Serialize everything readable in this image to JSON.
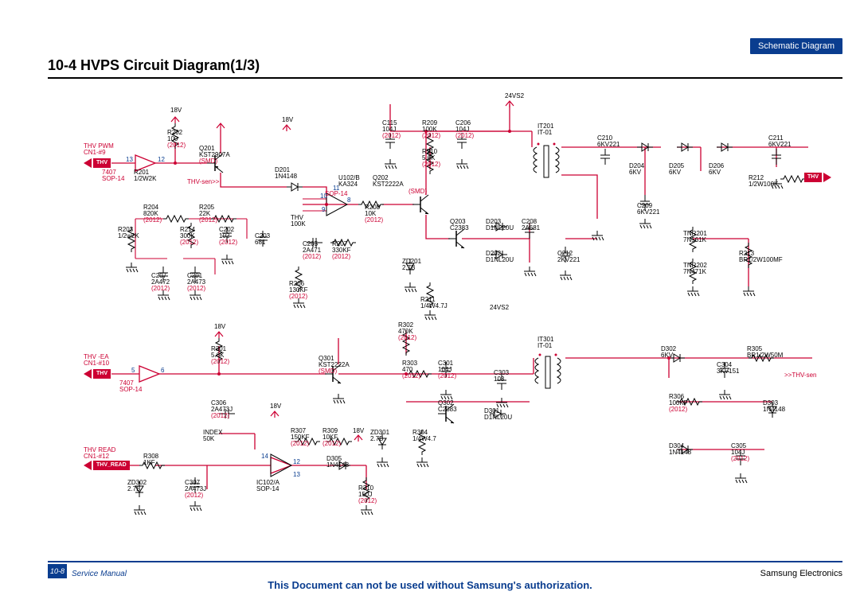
{
  "header": {
    "corner_label": "Schematic Diagram",
    "title": "10-4  HVPS Circuit Diagram(1/3)"
  },
  "footer": {
    "page_num": "10-8",
    "manual_label": "Service Manual",
    "center_text": "This Document can not be used without Samsung's authorization.",
    "right_text": "Samsung Electronics"
  },
  "rails": {
    "r24vs2_top": "24VS2",
    "r18v_a": "18V",
    "r18v_b": "18V",
    "r18v_c": "18V",
    "r18v_d": "18V",
    "r18v_e": "18V",
    "r24vs2_mid": "24VS2"
  },
  "signals": {
    "thv_pwm": "THV PWM\nCN1-#9",
    "thv_pill": "THV",
    "thv_sen": "THV-sen>>",
    "thv_ea": "THV -EA\nCN1-#10",
    "thv_ea_pill": "THV",
    "thv_read": "THV READ\nCN1-#12",
    "thv_read_pill": "THV_READ",
    "index": "INDEX\n50K",
    "thv_out": "THV",
    "thv_sen_out": ">>THV-sen"
  },
  "parts": {
    "r201": "R201\n1/2W2K",
    "r201_ic": "7407\nSOP-14",
    "r202": "R202\n100",
    "r202_pkg": "(2012)",
    "q201": "Q201\nKST2907A",
    "q201_pkg": "(SMD)",
    "d201": "D201\n1N4148",
    "u102b": "U102/B\nKA324",
    "u102b_pkg": "SOP-14",
    "q202": "Q202\nKST2222A",
    "q202_pkg": "(SMD)",
    "c115": "C115\n104J",
    "c115_pkg": "(2012)",
    "r209": "R209\n100K",
    "r209_pkg": "(2012)",
    "c206": "C206\n104J",
    "c206_pkg": "(2012)",
    "r210": "R210\n5.6K",
    "r210_pkg": "(2012)",
    "it201": "IT201\nIT-01",
    "c210": "C210\n6KV221",
    "c211": "C211\n6KV221",
    "d204": "D204\n6KV",
    "d205": "D205\n6KV",
    "d206": "D206\n6KV",
    "r212": "R212\n1/2W100K",
    "c209": "C209\n6KV221",
    "q203": "Q203\nC2383",
    "d203": "D203\nD1NL20U",
    "c208": "C208\n2A681",
    "d202": "D202\nD1NL20U",
    "c212": "C212\n2KV221",
    "tnr201": "TNR201\n7N561K",
    "tnr202": "TNR202\n7N471K",
    "r213": "R213\nBR1/2W100MF",
    "r204": "R204\n820K",
    "r204_pkg": "(2012)",
    "r205": "R205\n22K",
    "r205_pkg": "(2012)",
    "r214": "R214\n300K",
    "r214_pkg": "(2012)",
    "c202": "C202\n102",
    "c202_pkg": "(2012)",
    "c203": "C203\n681",
    "thv_tap": "THV\n100K",
    "r203": "R203\n1/2w2K",
    "c205": "C205\n2A471",
    "c205_pkg": "(2012)",
    "r207": "R207\n330KF",
    "r207_pkg": "(2012)",
    "r208": "R208\n10K",
    "r208_pkg": "(2012)",
    "zd201": "ZD201\n2.7B",
    "r211": "R211\n1/4W4.7J",
    "c207": "C207\n2A472",
    "c207_pkg": "(2012)",
    "c201": "C201\n2A473",
    "c201_pkg": "(2012)",
    "r206": "R206\n130KF",
    "r206_pkg": "(2012)",
    "r301": "R301\n5.6K",
    "r301_pkg": "(2012)",
    "r301_ic": "7407\nSOP-14",
    "q301": "Q301\nKST2222A",
    "q301_pkg": "(SMD)",
    "r302": "R302\n470K",
    "r302_pkg": "(2012)",
    "r303": "R303\n470",
    "r303_pkg": "(2012)",
    "c301": "C301\n104J",
    "c301_pkg": "(2012)",
    "c303": "C303\n103",
    "it301": "IT301\nIT-01",
    "d302": "D302\n6KV",
    "c304": "C304\n3KV151",
    "r305": "R305\nBR1/2W50M",
    "q302": "Q302\nC2383",
    "d301": "D301\nD1NL20U",
    "r306": "R306\n100KF",
    "r306_pkg": "(2012)",
    "d303": "D303\n1N4148",
    "c306": "C306\n2A473J",
    "c306_pkg": "(2012)",
    "r307": "R307\n150KF",
    "r307_pkg": "(2012)",
    "r309": "R309\n10KF",
    "r309_pkg": "(2012)",
    "zd301": "ZD301\n2.7B",
    "r304": "R304\n1/4W4.7",
    "d304": "D304\n1N4148",
    "c305": "C305\n104J",
    "c305_pkg": "(2012)",
    "r308": "R308\n1KF",
    "d305": "D305\n1N4148",
    "ic102a": "IC102/A\nSOP-14",
    "zd302": "ZD302\n2.7B",
    "c307": "C307\n2A473J",
    "c307_pkg": "(2012)",
    "r310": "R310\n150J",
    "r310_pkg": "(2012)",
    "pin12": "12",
    "pin13": "13",
    "pin5": "5",
    "pin6": "6",
    "pin14": "14",
    "pin12b": "12",
    "pin13b": "13",
    "pin8": "8",
    "pin9": "9",
    "pin10": "10",
    "pin11": "11"
  }
}
